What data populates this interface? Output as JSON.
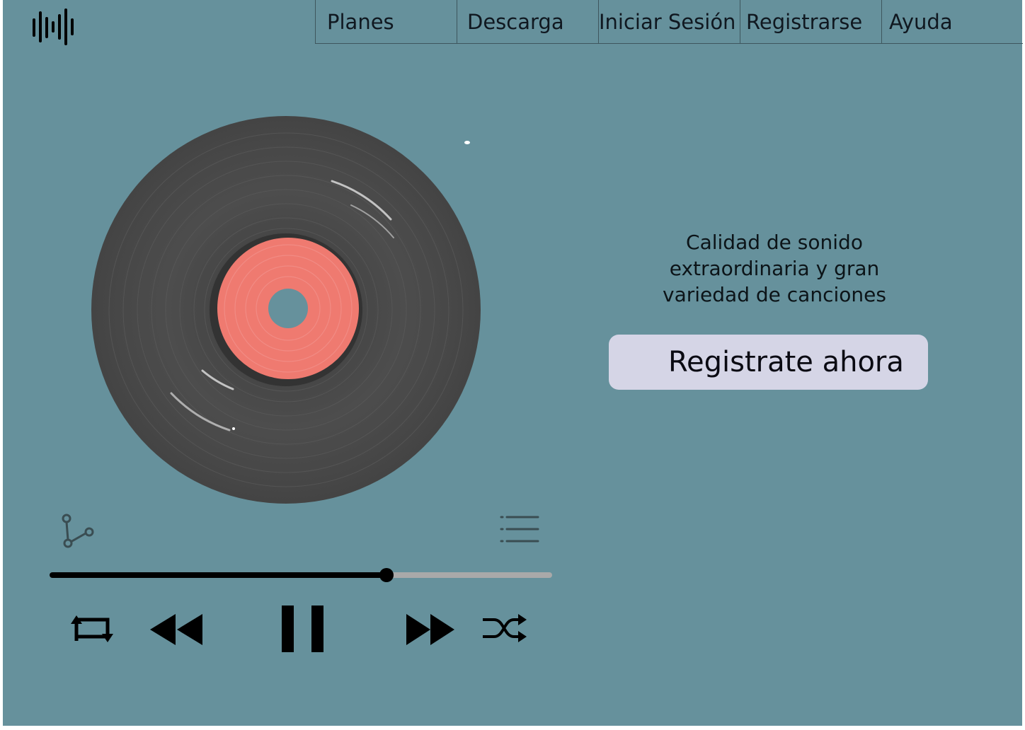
{
  "app": {
    "logo_icon": "soundwave-icon"
  },
  "nav": {
    "items": [
      {
        "label": "Planes"
      },
      {
        "label": "Descarga"
      },
      {
        "label": "Iniciar Sesión"
      },
      {
        "label": "Registrarse"
      },
      {
        "label": "Ayuda"
      }
    ]
  },
  "hero": {
    "tagline_line1": "Calidad de sonido",
    "tagline_line2": "extraordinaria y gran",
    "tagline_line3": "variedad de canciones",
    "cta_label": "Registrate ahora",
    "vinyl_icon": "vinyl-record-icon"
  },
  "player": {
    "progress": 0.67,
    "icons": {
      "share": "share-icon",
      "queue": "queue-list-icon",
      "repeat": "repeat-icon",
      "rewind": "rewind-icon",
      "pause": "pause-icon",
      "fast_forward": "fast-forward-icon",
      "shuffle": "shuffle-icon"
    }
  },
  "colors": {
    "background": "#66919c",
    "record": "#4a4a4a",
    "label": "#ef7a70",
    "button": "#d5d5e6",
    "progress_fill": "#000000",
    "progress_track": "#a9a9a9"
  }
}
